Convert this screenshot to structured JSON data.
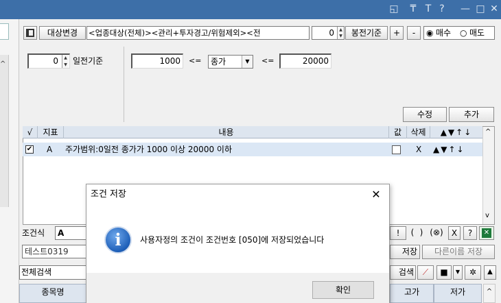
{
  "titlebar": {
    "icons": [
      {
        "name": "window-restore-icon",
        "glyph": "◱"
      },
      {
        "name": "pin-icon",
        "glyph": "₸"
      },
      {
        "name": "font-icon",
        "glyph": "T"
      },
      {
        "name": "help-icon",
        "glyph": "?"
      },
      {
        "name": "minimize-icon",
        "glyph": "—"
      },
      {
        "name": "maximize-icon",
        "glyph": "□"
      },
      {
        "name": "close-icon",
        "glyph": "✕"
      }
    ]
  },
  "toolbar": {
    "target_change_label": "대상변경",
    "target_text": "<업종대상(전체)><관리+투자경고/위험제외><전",
    "candle_value": "0",
    "candle_label": "봉전기준",
    "plus_label": "+",
    "minus_label": "-",
    "buy_label": "매수",
    "sell_label": "매도"
  },
  "condition": {
    "days_value": "0",
    "days_label": "일전기준",
    "min_value": "1000",
    "op1": "<=",
    "field_value": "종가",
    "op2": "<=",
    "max_value": "20000"
  },
  "actions": {
    "modify_label": "수정",
    "add_label": "추가"
  },
  "grid": {
    "headers": {
      "check": "√",
      "indicator": "지표",
      "content": "내용",
      "value": "값",
      "delete": "삭제",
      "move": "▲▼↑↓"
    },
    "rows": [
      {
        "indicator": "A",
        "content": "주가범위:0일전 종가가 1000 이상 20000 이하",
        "delete": "X",
        "move": "▲▼↑↓"
      }
    ]
  },
  "formula": {
    "label": "조건식",
    "value": "A",
    "ops": [
      "!",
      "(",
      ")",
      "(⊗)",
      "X",
      "?"
    ]
  },
  "save_row": {
    "name_value": "테스트0319",
    "save_label": "저장",
    "save_as_label": "다른이름 저장"
  },
  "search_row": {
    "left_label": "전체검색",
    "right_label": "검색"
  },
  "results": {
    "headers": [
      "종목명",
      "고가",
      "저가"
    ]
  },
  "dialog": {
    "title": "조건 저장",
    "message": "사용자정의 조건이 조건번호 [050]에 저장되었습니다",
    "ok_label": "확인"
  },
  "colors": {
    "titlebar": "#3d6fa8",
    "grid_header": "#dde5ef",
    "selected_row": "#dbe7f5",
    "info_icon": "#1e5fb8"
  }
}
